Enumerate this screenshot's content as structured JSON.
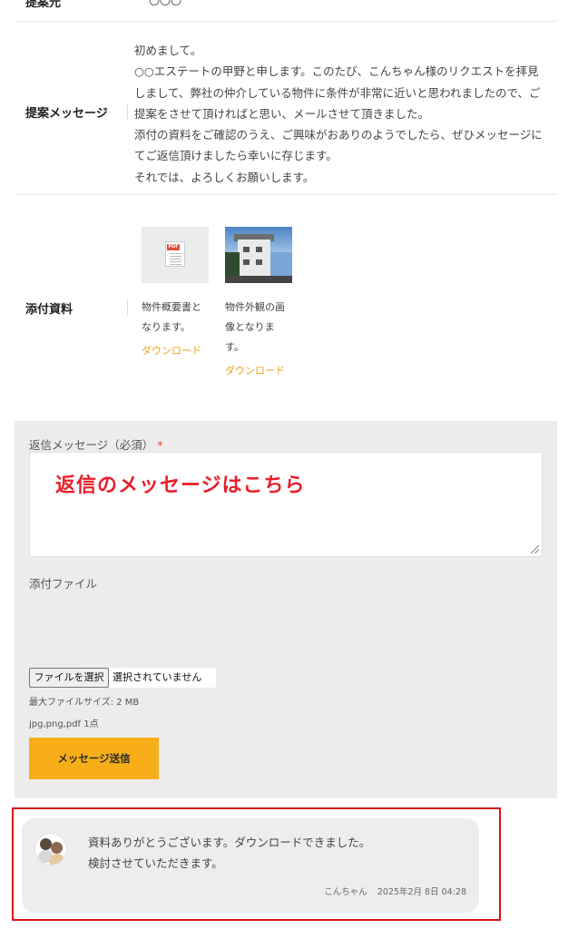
{
  "top_row": {
    "label": "提案元",
    "value": "〇〇〇"
  },
  "proposal": {
    "label": "提案メッセージ",
    "lines": [
      "初めまして。",
      "○○エステートの甲野と申します。このたび、こんちゃん様のリクエストを拝見",
      "しまして、弊社の仲介している物件に条件が非常に近いと思われましたので、ご",
      "提案をさせて頂ければと思い、メールさせて頂きました。",
      "添付の資料をご確認のうえ、ご興味がおありのようでしたら、ぜひメッセージに",
      "てご返信頂けましたら幸いに存じます。",
      "それでは、よろしくお願いします。"
    ]
  },
  "attachments": {
    "label": "添付資料",
    "items": [
      {
        "icon": "pdf-file-icon",
        "caption": [
          "物件概要書と",
          "なります。"
        ],
        "link": "ダウンロード"
      },
      {
        "icon": "house-photo",
        "caption": [
          "物件外観の画",
          "像となりま",
          "す。"
        ],
        "link": "ダウンロード"
      }
    ]
  },
  "reply": {
    "label": "返信メッセージ（必須）",
    "required_mark": "*",
    "placeholder": "返信のメッセージはこちら",
    "file_label": "添付ファイル",
    "file_button": "ファイルを選択",
    "file_status": "選択されていません",
    "max_size": "最大ファイルサイズ: 2 MB",
    "file_types": "jpg,png,pdf 1点",
    "send_button": "メッセージ送信"
  },
  "reply_message": {
    "lines": [
      "資料ありがとうございます。ダウンロードできました。",
      "検討させていただきます。"
    ],
    "author": "こんちゃん",
    "timestamp": "2025年2月 8日 04:28"
  },
  "colors": {
    "accent": "#f7ae19",
    "link": "#e9a316",
    "required": "#e2452e",
    "placeholder_red": "#e8202a",
    "highlight_border": "#d8141b"
  }
}
